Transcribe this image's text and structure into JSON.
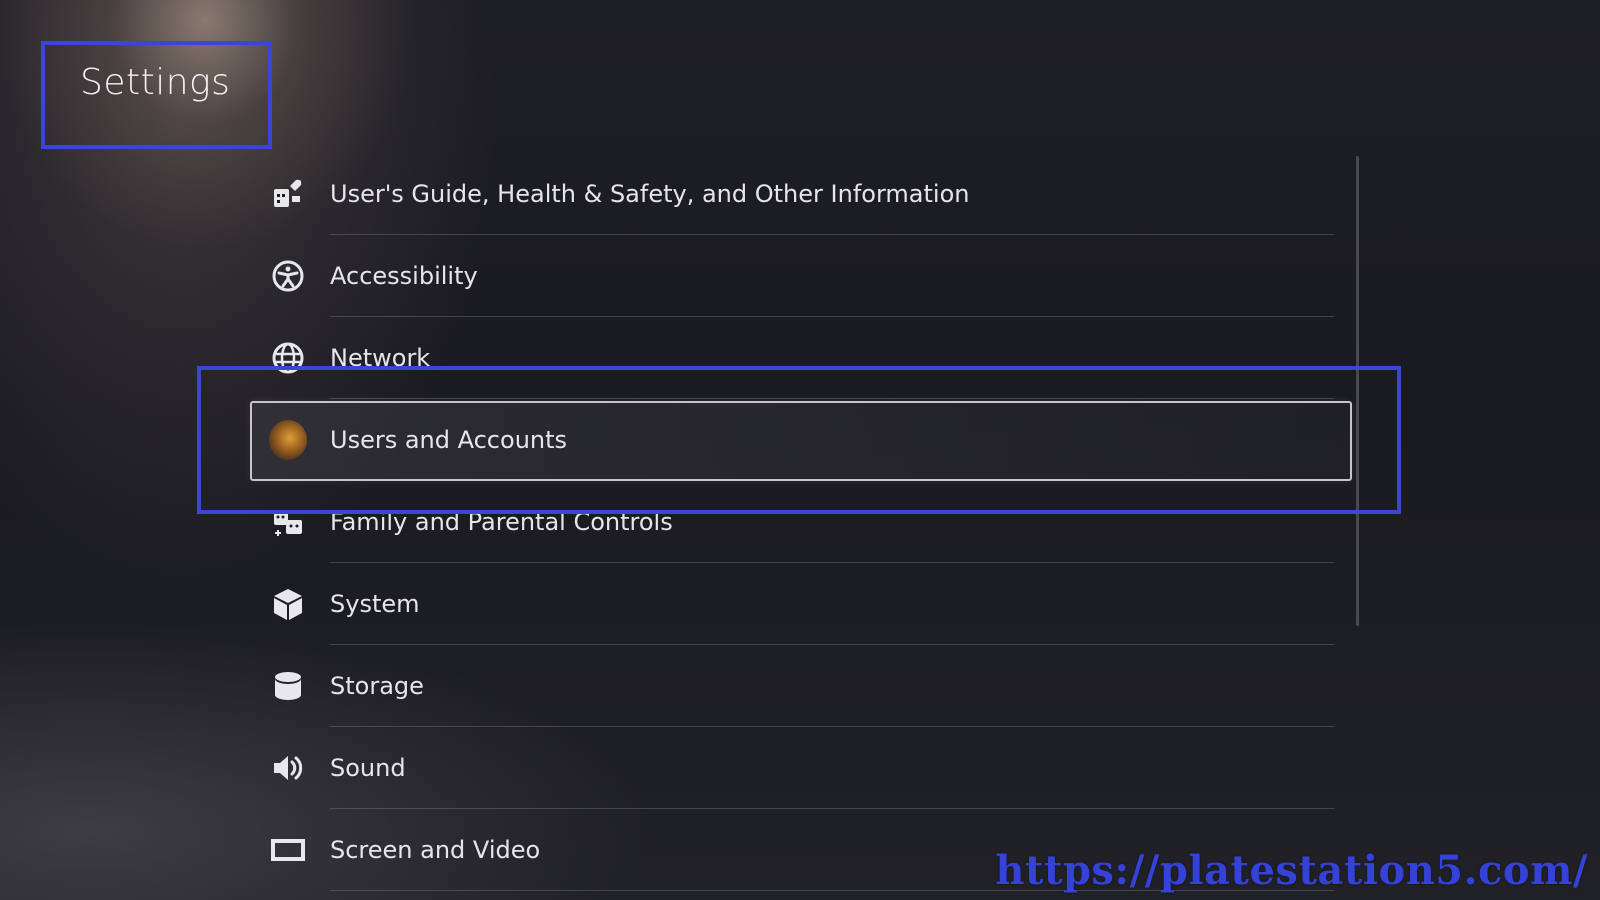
{
  "header": {
    "title": "Settings"
  },
  "menu": {
    "items": [
      {
        "label": "User's Guide, Health & Safety, and Other Information",
        "icon": "guide-icon"
      },
      {
        "label": "Accessibility",
        "icon": "accessibility-icon"
      },
      {
        "label": "Network",
        "icon": "globe-icon"
      },
      {
        "label": "Users and Accounts",
        "icon": "avatar",
        "focused": true
      },
      {
        "label": "Family and Parental Controls",
        "icon": "family-icon"
      },
      {
        "label": "System",
        "icon": "cube-icon"
      },
      {
        "label": "Storage",
        "icon": "storage-icon"
      },
      {
        "label": "Sound",
        "icon": "speaker-icon"
      },
      {
        "label": "Screen and Video",
        "icon": "screen-icon"
      }
    ]
  },
  "watermark": {
    "text": "https://platestation5.com/"
  },
  "colors": {
    "highlight": "#3b46d6",
    "watermark": "#3542d8"
  }
}
